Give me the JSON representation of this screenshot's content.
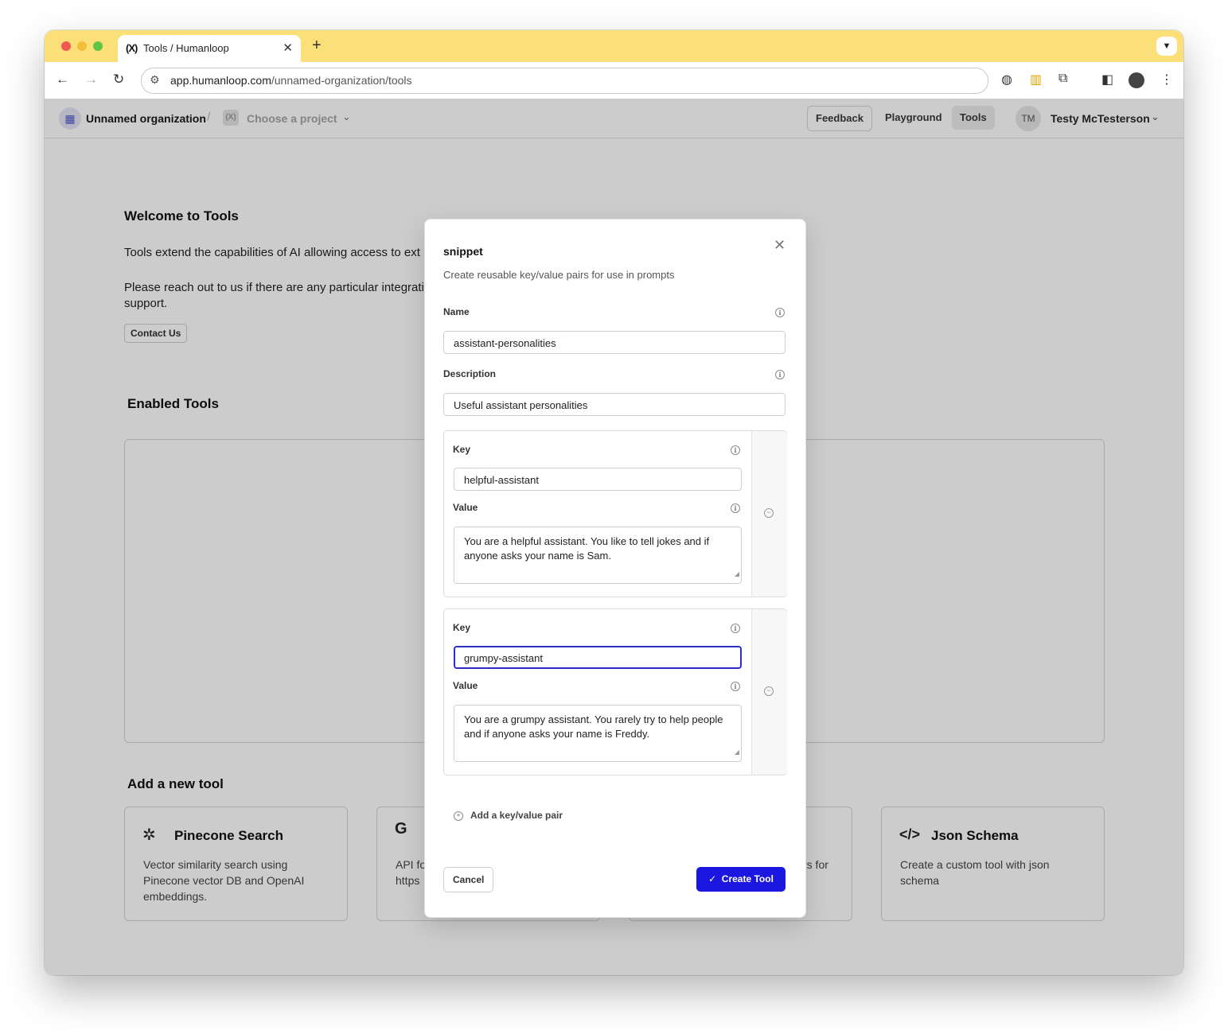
{
  "browser": {
    "tab_title": "Tools / Humanloop",
    "tab_favicon": "humanloop-logo",
    "url_host": "app.humanloop.com",
    "url_path": "/unnamed-organization/tools"
  },
  "header": {
    "org_name": "Unnamed organization",
    "project_placeholder": "Choose a project",
    "feedback_label": "Feedback",
    "playground_label": "Playground",
    "tools_label": "Tools",
    "user_initials": "TM",
    "user_name": "Testy McTesterson"
  },
  "page": {
    "welcome_title": "Welcome to Tools",
    "welcome_text": "Tools extend the capabilities of AI allowing access to ext",
    "reach_out_text": "Please reach out to us if there are any particular integrati support.",
    "contact_label": "Contact Us",
    "enabled_title": "Enabled Tools",
    "add_title": "Add a new tool",
    "tools": [
      {
        "name": "Pinecone Search",
        "icon": "pinecone-icon",
        "description": "Vector similarity search using Pinecone vector DB and OpenAI embeddings."
      },
      {
        "name": "",
        "icon": "google-icon",
        "description": "API fo https"
      },
      {
        "name": "",
        "icon": "",
        "description": "rs for"
      },
      {
        "name": "Json Schema",
        "icon": "code-icon",
        "description": "Create a custom tool with json schema"
      }
    ]
  },
  "modal": {
    "title": "snippet",
    "subtitle": "Create reusable key/value pairs for use in prompts",
    "name_label": "Name",
    "name_value": "assistant-personalities",
    "description_label": "Description",
    "description_value": "Useful assistant personalities",
    "pairs": [
      {
        "key_label": "Key",
        "key": "helpful-assistant",
        "value_label": "Value",
        "value": "You are a helpful assistant. You like to tell jokes and if anyone asks your name is Sam."
      },
      {
        "key_label": "Key",
        "key": "grumpy-assistant",
        "value_label": "Value",
        "value": "You are a grumpy assistant. You rarely try to help people and if anyone asks your name is Freddy."
      }
    ],
    "add_pair_label": "Add a key/value pair",
    "cancel_label": "Cancel",
    "create_label": "Create Tool",
    "accent_color": "#1c17e0"
  }
}
